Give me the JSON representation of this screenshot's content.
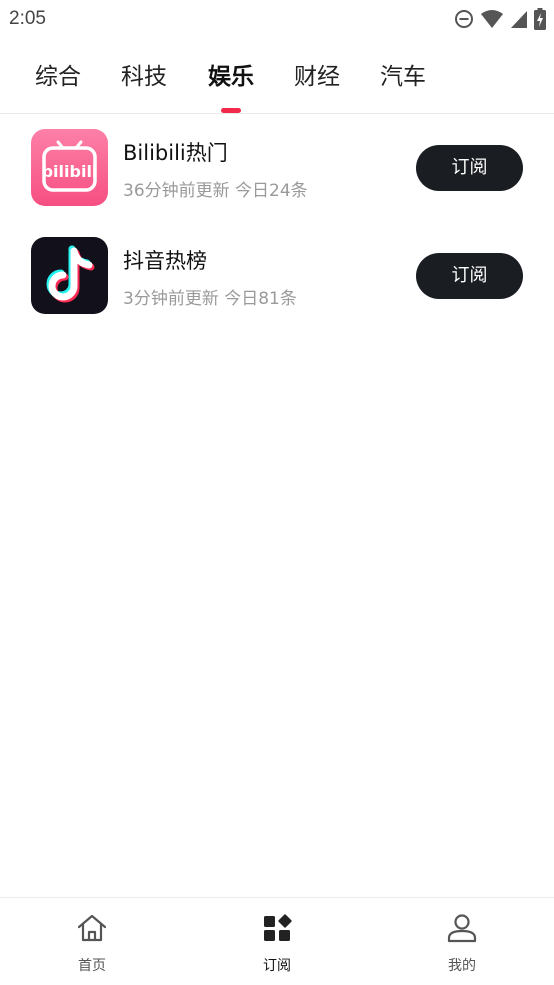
{
  "status_bar": {
    "time": "2:05",
    "icons": [
      "do-not-disturb-icon",
      "wifi-icon",
      "cellular-signal-icon",
      "battery-charging-icon"
    ]
  },
  "tabs": [
    {
      "label": "综合",
      "active": false
    },
    {
      "label": "科技",
      "active": false
    },
    {
      "label": "娱乐",
      "active": true
    },
    {
      "label": "财经",
      "active": false
    },
    {
      "label": "汽车",
      "active": false
    }
  ],
  "colors": {
    "accent": "#f2294a",
    "button_bg": "#1a1d21",
    "bilibili_pink": "#fb7299",
    "tiktok_dark": "#12101a"
  },
  "feeds": [
    {
      "title": "Bilibili热门",
      "meta": "36分钟前更新 今日24条",
      "button": "订阅",
      "logo": "bilibili-logo-icon",
      "logo_text": "bilibili"
    },
    {
      "title": "抖音热榜",
      "meta": "3分钟前更新 今日81条",
      "button": "订阅",
      "logo": "tiktok-logo-icon"
    }
  ],
  "bottom_nav": [
    {
      "label": "首页",
      "icon": "home-icon",
      "active": false
    },
    {
      "label": "订阅",
      "icon": "grid-icon",
      "active": true
    },
    {
      "label": "我的",
      "icon": "user-icon",
      "active": false
    }
  ]
}
